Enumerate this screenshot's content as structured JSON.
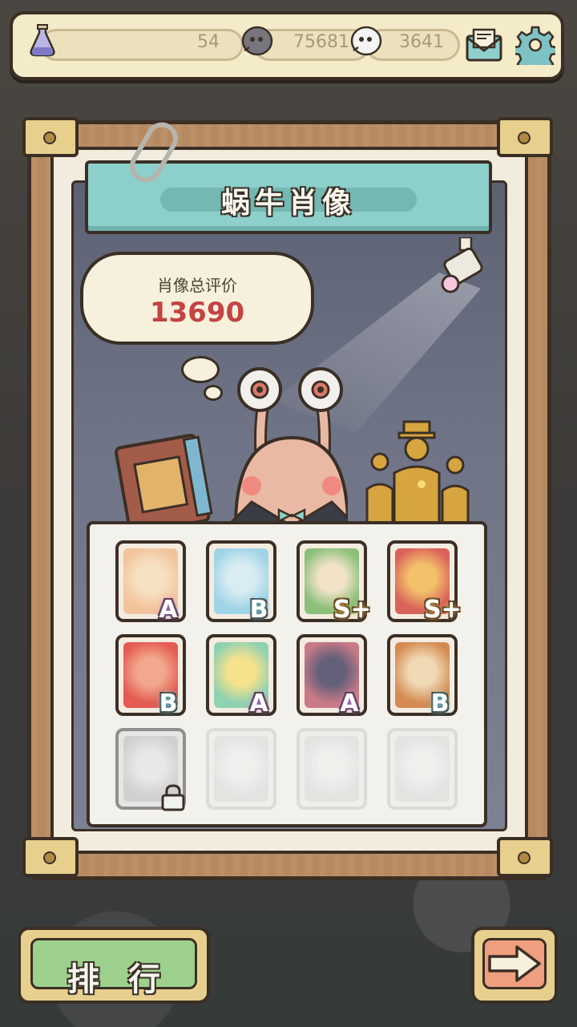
{
  "resources": {
    "potion": {
      "icon": "potion-icon",
      "value": "54"
    },
    "dark_shell": {
      "icon": "dark-shell-icon",
      "value": "75681"
    },
    "white_shell": {
      "icon": "white-shell-icon",
      "value": "3641"
    }
  },
  "header_buttons": [
    "mail-icon",
    "gear-icon"
  ],
  "title": "蜗牛肖像",
  "portrait": {
    "label": "肖像总评价",
    "score": "13690"
  },
  "cards": [
    {
      "name": "snail",
      "grade": "A",
      "state": "unlocked",
      "colors": [
        "#f2c49c",
        "#f6e1c3"
      ]
    },
    {
      "name": "cyan-girl",
      "grade": "B",
      "state": "unlocked",
      "colors": [
        "#9fd4e6",
        "#d9ecf2"
      ]
    },
    {
      "name": "green-cap-guy",
      "grade": "S+",
      "state": "unlocked",
      "colors": [
        "#8bc07a",
        "#f1e2c8"
      ]
    },
    {
      "name": "bearded-king",
      "grade": "S+",
      "state": "unlocked",
      "colors": [
        "#d9635a",
        "#f3c16a"
      ]
    },
    {
      "name": "red-crab",
      "grade": "B",
      "state": "unlocked",
      "colors": [
        "#e35b52",
        "#f3a88d"
      ]
    },
    {
      "name": "rainbow-gem",
      "grade": "A",
      "state": "unlocked",
      "colors": [
        "#8fd2b2",
        "#f6e28c"
      ]
    },
    {
      "name": "brain-mask",
      "grade": "A",
      "state": "unlocked",
      "colors": [
        "#c97a87",
        "#65607a"
      ]
    },
    {
      "name": "tiger",
      "grade": "B",
      "state": "unlocked",
      "colors": [
        "#d48b52",
        "#f1d9b5"
      ]
    },
    {
      "name": "machine",
      "grade": "",
      "state": "locked",
      "colors": [
        "#d0d0ce",
        "#e8e8e6"
      ]
    },
    {
      "name": "spore",
      "grade": "",
      "state": "faded",
      "colors": [
        "#e0e0de",
        "#efefed"
      ]
    },
    {
      "name": "rock-flower",
      "grade": "",
      "state": "faded",
      "colors": [
        "#e0e0de",
        "#efefed"
      ]
    },
    {
      "name": "blob",
      "grade": "",
      "state": "faded",
      "colors": [
        "#e0e0de",
        "#efefed"
      ]
    }
  ],
  "grade_colors": {
    "A": "#c67ee8",
    "B": "#6fd2e6",
    "S+": "#f2b24c"
  },
  "buttons": {
    "rank": "排行",
    "next_icon": "arrow-right-icon"
  }
}
